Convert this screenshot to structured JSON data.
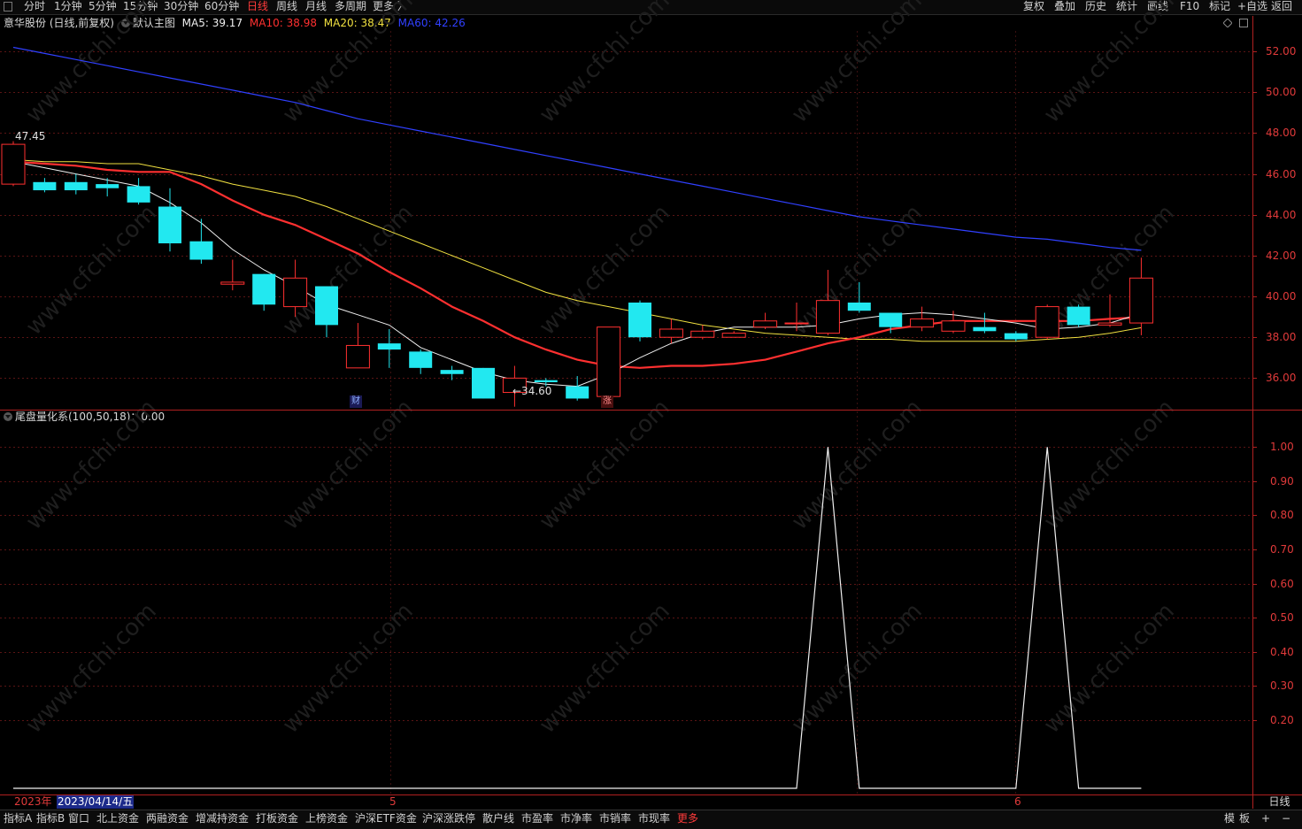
{
  "toolbar": {
    "periods": [
      "分时",
      "1分钟",
      "5分钟",
      "15分钟",
      "30分钟",
      "60分钟",
      "日线",
      "周线",
      "月线",
      "多周期",
      "更多 〉"
    ],
    "active_period": "日线",
    "right": [
      "复权",
      "叠加",
      "历史",
      "统计",
      "画线",
      "F10",
      "标记",
      "+自选",
      "返回"
    ]
  },
  "legend": {
    "stock": "意华股份 (日线,前复权)",
    "main": "默认主图",
    "ma5": "MA5: 39.17",
    "ma10": "MA10: 38.98",
    "ma20": "MA20: 38.47",
    "ma60": "MA60: 42.26",
    "colors": {
      "ma5": "#f0f0f0",
      "ma10": "#ff3030",
      "ma20": "#f0e040",
      "ma60": "#3040ff",
      "up": "#ff3030",
      "down": "#22e8f0"
    }
  },
  "sub_legend": {
    "label": "尾盘量化系(100,50,18)：0.00"
  },
  "marks": {
    "high_label": "47.45",
    "low_label": "←34.60",
    "cai": "财",
    "zhang": "涨"
  },
  "price_axis": [
    "52.00",
    "50.00",
    "48.00",
    "46.00",
    "44.00",
    "42.00",
    "40.00",
    "38.00",
    "36.00"
  ],
  "sub_axis": [
    "1.00",
    "0.90",
    "0.80",
    "0.70",
    "0.60",
    "0.50",
    "0.40",
    "0.30",
    "0.20"
  ],
  "date_bar": {
    "year": "2023年",
    "cursor": "2023/04/14/五",
    "m5": "5",
    "m6": "6"
  },
  "period_tag": "日线",
  "bottom_tabs": [
    "指标A",
    "指标B",
    "窗口",
    "北上资金",
    "两融资金",
    "增减持资金",
    "打板资金",
    "上榜资金",
    "沪深ETF资金",
    "沪深涨跌停",
    "散户线",
    "市盈率",
    "市净率",
    "市销率",
    "市现率",
    "更多"
  ],
  "bottom_right": [
    "模",
    "板",
    "+",
    "−"
  ],
  "chart_data": {
    "type": "candlestick",
    "title": "意华股份 (日线,前复权)",
    "ylim": [
      34.5,
      53.0
    ],
    "candles": [
      {
        "o": 45.5,
        "c": 47.45,
        "h": 47.6,
        "l": 45.4
      },
      {
        "o": 45.6,
        "c": 45.2,
        "h": 45.8,
        "l": 45.1
      },
      {
        "o": 45.6,
        "c": 45.2,
        "h": 46.0,
        "l": 45.0
      },
      {
        "o": 45.5,
        "c": 45.3,
        "h": 45.8,
        "l": 44.9
      },
      {
        "o": 45.4,
        "c": 44.6,
        "h": 45.8,
        "l": 44.5
      },
      {
        "o": 44.4,
        "c": 42.6,
        "h": 45.3,
        "l": 42.2
      },
      {
        "o": 42.7,
        "c": 41.8,
        "h": 43.8,
        "l": 41.6
      },
      {
        "o": 40.6,
        "c": 40.7,
        "h": 41.8,
        "l": 40.3
      },
      {
        "o": 41.1,
        "c": 39.6,
        "h": 41.1,
        "l": 39.3
      },
      {
        "o": 39.5,
        "c": 40.9,
        "h": 41.8,
        "l": 39.0
      },
      {
        "o": 40.5,
        "c": 38.6,
        "h": 40.5,
        "l": 38.0
      },
      {
        "o": 36.5,
        "c": 37.6,
        "h": 38.7,
        "l": 36.5
      },
      {
        "o": 37.7,
        "c": 37.4,
        "h": 38.4,
        "l": 36.5
      },
      {
        "o": 37.3,
        "c": 36.5,
        "h": 37.4,
        "l": 36.2
      },
      {
        "o": 36.4,
        "c": 36.2,
        "h": 36.6,
        "l": 35.9
      },
      {
        "o": 36.5,
        "c": 35.0,
        "h": 36.5,
        "l": 35.0
      },
      {
        "o": 35.3,
        "c": 36.0,
        "h": 36.6,
        "l": 34.6
      },
      {
        "o": 35.9,
        "c": 35.8,
        "h": 36.0,
        "l": 35.6
      },
      {
        "o": 35.6,
        "c": 35.0,
        "h": 36.1,
        "l": 34.9
      },
      {
        "o": 35.1,
        "c": 38.5,
        "h": 38.5,
        "l": 35.0
      },
      {
        "o": 39.7,
        "c": 38.0,
        "h": 39.8,
        "l": 37.8
      },
      {
        "o": 38.0,
        "c": 38.4,
        "h": 38.9,
        "l": 37.7
      },
      {
        "o": 38.0,
        "c": 38.3,
        "h": 38.6,
        "l": 37.9
      },
      {
        "o": 38.0,
        "c": 38.2,
        "h": 38.3,
        "l": 38.0
      },
      {
        "o": 38.5,
        "c": 38.8,
        "h": 39.2,
        "l": 38.4
      },
      {
        "o": 38.7,
        "c": 38.7,
        "h": 39.7,
        "l": 38.3
      },
      {
        "o": 38.2,
        "c": 39.8,
        "h": 41.3,
        "l": 38.1
      },
      {
        "o": 39.7,
        "c": 39.3,
        "h": 40.7,
        "l": 39.2
      },
      {
        "o": 39.2,
        "c": 38.5,
        "h": 39.2,
        "l": 38.2
      },
      {
        "o": 38.5,
        "c": 38.9,
        "h": 39.5,
        "l": 38.3
      },
      {
        "o": 38.3,
        "c": 38.8,
        "h": 39.3,
        "l": 38.2
      },
      {
        "o": 38.5,
        "c": 38.3,
        "h": 39.2,
        "l": 38.2
      },
      {
        "o": 38.2,
        "c": 37.9,
        "h": 38.3,
        "l": 37.8
      },
      {
        "o": 38.0,
        "c": 39.5,
        "h": 39.6,
        "l": 37.9
      },
      {
        "o": 39.5,
        "c": 38.6,
        "h": 39.6,
        "l": 38.5
      },
      {
        "o": 38.6,
        "c": 38.7,
        "h": 40.1,
        "l": 38.5
      },
      {
        "o": 38.7,
        "c": 40.9,
        "h": 41.9,
        "l": 38.1
      }
    ],
    "ma5": [
      46.6,
      46.3,
      46.0,
      45.7,
      45.4,
      44.6,
      43.6,
      42.3,
      41.3,
      40.5,
      39.6,
      39.1,
      38.6,
      37.5,
      36.9,
      36.3,
      35.9,
      35.7,
      35.6,
      36.2,
      37.0,
      37.7,
      38.2,
      38.5,
      38.5,
      38.5,
      38.6,
      38.9,
      39.1,
      39.2,
      39.1,
      38.9,
      38.7,
      38.4,
      38.5,
      38.7,
      39.17
    ],
    "ma10": [
      46.6,
      46.5,
      46.4,
      46.2,
      46.1,
      46.1,
      45.5,
      44.7,
      44.0,
      43.5,
      42.8,
      42.1,
      41.2,
      40.4,
      39.5,
      38.8,
      38.0,
      37.4,
      36.9,
      36.6,
      36.5,
      36.6,
      36.6,
      36.7,
      36.9,
      37.3,
      37.7,
      38.0,
      38.4,
      38.6,
      38.8,
      38.8,
      38.8,
      38.8,
      38.8,
      38.9,
      38.98
    ],
    "ma20": [
      46.7,
      46.6,
      46.6,
      46.5,
      46.5,
      46.2,
      45.9,
      45.5,
      45.2,
      44.9,
      44.4,
      43.8,
      43.2,
      42.6,
      42.0,
      41.4,
      40.8,
      40.2,
      39.8,
      39.5,
      39.2,
      38.9,
      38.6,
      38.4,
      38.2,
      38.1,
      38.0,
      37.9,
      37.9,
      37.8,
      37.8,
      37.8,
      37.8,
      37.9,
      38.0,
      38.2,
      38.47
    ],
    "ma60": [
      52.2,
      51.9,
      51.6,
      51.3,
      51.0,
      50.7,
      50.4,
      50.1,
      49.8,
      49.5,
      49.1,
      48.7,
      48.4,
      48.1,
      47.8,
      47.5,
      47.2,
      46.9,
      46.6,
      46.3,
      46.0,
      45.7,
      45.4,
      45.1,
      44.8,
      44.5,
      44.2,
      43.9,
      43.7,
      43.5,
      43.3,
      43.1,
      42.9,
      42.8,
      42.6,
      42.4,
      42.26
    ],
    "indicator": {
      "name": "尾盘量化系",
      "ylim": [
        0.0,
        1.05
      ],
      "values": [
        0,
        0,
        0,
        0,
        0,
        0,
        0,
        0,
        0,
        0,
        0,
        0,
        0,
        0,
        0,
        0,
        0,
        0,
        0,
        0,
        0,
        0,
        0,
        0,
        0,
        0,
        1,
        0,
        0,
        0,
        0,
        0,
        0,
        1,
        0,
        0,
        0
      ]
    }
  }
}
